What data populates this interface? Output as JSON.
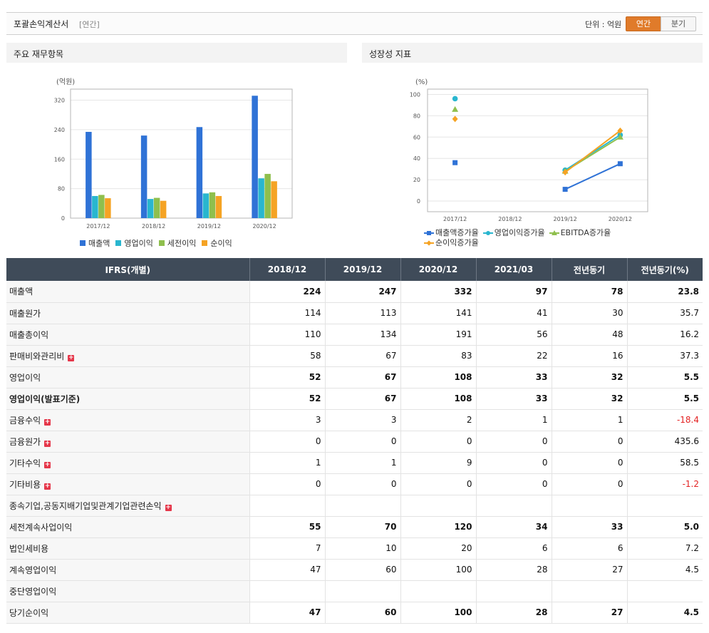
{
  "header": {
    "title": "포괄손익계산서",
    "subtitle": "[연간]",
    "unit_label": "단위 : 억원",
    "period_annual": "연간",
    "period_quarter": "분기"
  },
  "left_panel": {
    "title": "주요 재무항목"
  },
  "right_panel": {
    "title": "성장성 지표"
  },
  "chart_data": [
    {
      "type": "bar",
      "ylabel": "(억원)",
      "categories": [
        "2017/12",
        "2018/12",
        "2019/12",
        "2020/12"
      ],
      "ylim": [
        0,
        350
      ],
      "yticks": [
        0,
        80,
        160,
        240,
        320
      ],
      "grid": true,
      "legend_position": "bottom",
      "series": [
        {
          "name": "매출액",
          "color": "#2f72d6",
          "values": [
            234,
            224,
            247,
            332
          ]
        },
        {
          "name": "영업이익",
          "color": "#29b6cf",
          "values": [
            60,
            52,
            67,
            108
          ]
        },
        {
          "name": "세전이익",
          "color": "#8fbf4d",
          "values": [
            63,
            55,
            70,
            120
          ]
        },
        {
          "name": "순이익",
          "color": "#f5a324",
          "values": [
            54,
            47,
            60,
            100
          ]
        }
      ]
    },
    {
      "type": "line",
      "ylabel": "(%)",
      "categories": [
        "2017/12",
        "2018/12",
        "2019/12",
        "2020/12"
      ],
      "ylim": [
        -10,
        105
      ],
      "yticks": [
        0,
        20,
        40,
        60,
        80,
        100
      ],
      "grid": true,
      "legend_position": "bottom",
      "series": [
        {
          "name": "매출액증가율",
          "color": "#2f72d6",
          "marker": "square",
          "values": [
            36,
            null,
            11,
            35
          ]
        },
        {
          "name": "영업이익증가율",
          "color": "#29b6cf",
          "marker": "circle",
          "values": [
            96,
            null,
            29,
            62
          ]
        },
        {
          "name": "EBITDA증가율",
          "color": "#8fbf4d",
          "marker": "triangle",
          "values": [
            86,
            null,
            28,
            60
          ]
        },
        {
          "name": "순이익증가율",
          "color": "#f5a324",
          "marker": "diamond",
          "values": [
            77,
            null,
            27,
            66
          ]
        }
      ]
    }
  ],
  "table": {
    "header": [
      "IFRS(개별)",
      "2018/12",
      "2019/12",
      "2020/12",
      "2021/03",
      "전년동기",
      "전년동기(%)"
    ],
    "rows": [
      {
        "label": "매출액",
        "values": [
          "224",
          "247",
          "332",
          "97",
          "78",
          "23.8"
        ],
        "bold": true,
        "expand": false
      },
      {
        "label": "매출원가",
        "values": [
          "114",
          "113",
          "141",
          "41",
          "30",
          "35.7"
        ],
        "bold": false,
        "expand": false
      },
      {
        "label": "매출총이익",
        "values": [
          "110",
          "134",
          "191",
          "56",
          "48",
          "16.2"
        ],
        "bold": false,
        "expand": false
      },
      {
        "label": "판매비와관리비",
        "values": [
          "58",
          "67",
          "83",
          "22",
          "16",
          "37.3"
        ],
        "bold": false,
        "expand": true
      },
      {
        "label": "영업이익",
        "values": [
          "52",
          "67",
          "108",
          "33",
          "32",
          "5.5"
        ],
        "bold": true,
        "expand": false
      },
      {
        "label": "영업이익(발표기준)",
        "values": [
          "52",
          "67",
          "108",
          "33",
          "32",
          "5.5"
        ],
        "bold": true,
        "expand": false,
        "label_bold": true
      },
      {
        "label": "금융수익",
        "values": [
          "3",
          "3",
          "2",
          "1",
          "1",
          "-18.4"
        ],
        "bold": false,
        "expand": true
      },
      {
        "label": "금융원가",
        "values": [
          "0",
          "0",
          "0",
          "0",
          "0",
          "435.6"
        ],
        "bold": false,
        "expand": true
      },
      {
        "label": "기타수익",
        "values": [
          "1",
          "1",
          "9",
          "0",
          "0",
          "58.5"
        ],
        "bold": false,
        "expand": true
      },
      {
        "label": "기타비용",
        "values": [
          "0",
          "0",
          "0",
          "0",
          "0",
          "-1.2"
        ],
        "bold": false,
        "expand": true
      },
      {
        "label": "종속기업,공동지배기업및관계기업관련손익",
        "values": [
          "",
          "",
          "",
          "",
          "",
          ""
        ],
        "bold": false,
        "expand": true
      },
      {
        "label": "세전계속사업이익",
        "values": [
          "55",
          "70",
          "120",
          "34",
          "33",
          "5.0"
        ],
        "bold": true,
        "expand": false
      },
      {
        "label": "법인세비용",
        "values": [
          "7",
          "10",
          "20",
          "6",
          "6",
          "7.2"
        ],
        "bold": false,
        "expand": false
      },
      {
        "label": "계속영업이익",
        "values": [
          "47",
          "60",
          "100",
          "28",
          "27",
          "4.5"
        ],
        "bold": false,
        "expand": false
      },
      {
        "label": "중단영업이익",
        "values": [
          "",
          "",
          "",
          "",
          "",
          ""
        ],
        "bold": false,
        "expand": false
      },
      {
        "label": "당기순이익",
        "values": [
          "47",
          "60",
          "100",
          "28",
          "27",
          "4.5"
        ],
        "bold": true,
        "expand": false
      }
    ]
  }
}
